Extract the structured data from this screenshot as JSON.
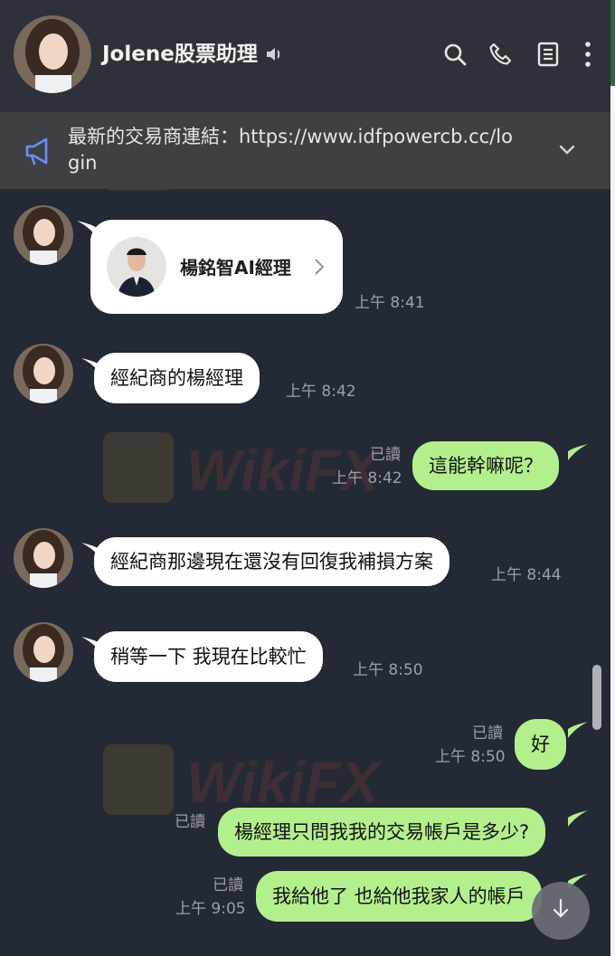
{
  "header": {
    "contact_name": "Jolene股票助理"
  },
  "announcement": {
    "text": "最新的交易商連結：https://www.idfpowercb.cc/login"
  },
  "watermark": {
    "text": "WikiFX"
  },
  "messages": [
    {
      "type": "card",
      "direction": "incoming",
      "card_name": "楊銘智AI經理",
      "time": "上午 8:41"
    },
    {
      "type": "text",
      "direction": "incoming",
      "text": "經紀商的楊經理",
      "time": "上午 8:42"
    },
    {
      "type": "text",
      "direction": "outgoing",
      "text": "這能幹嘛呢？",
      "read": "已讀",
      "time": "上午 8:42"
    },
    {
      "type": "text",
      "direction": "incoming",
      "text": "經紀商那邊現在還沒有回復我補損方案",
      "time": "上午 8:44"
    },
    {
      "type": "text",
      "direction": "incoming",
      "text": "稍等一下 我現在比較忙",
      "time": "上午 8:50"
    },
    {
      "type": "text",
      "direction": "outgoing",
      "text": "好",
      "read": "已讀",
      "time": "上午 8:50"
    },
    {
      "type": "text",
      "direction": "outgoing",
      "text": "楊經理只問我我的交易帳戶是多少?",
      "read": "已讀",
      "time": ""
    },
    {
      "type": "text",
      "direction": "outgoing",
      "text": "我給他了  也給他我家人的帳戶",
      "read": "已讀",
      "time": "上午 9:05"
    }
  ],
  "colors": {
    "chat_background": "#232935",
    "header_background": "#2e3139",
    "outgoing_bubble": "#b4ef8e",
    "incoming_bubble": "#ffffff",
    "accent_icon": "#6f8cff"
  },
  "icons": [
    "speaker-icon",
    "search-icon",
    "phone-icon",
    "notes-icon",
    "more-icon",
    "megaphone-icon",
    "chevron-down-icon",
    "chevron-right-icon",
    "arrow-down-icon"
  ]
}
